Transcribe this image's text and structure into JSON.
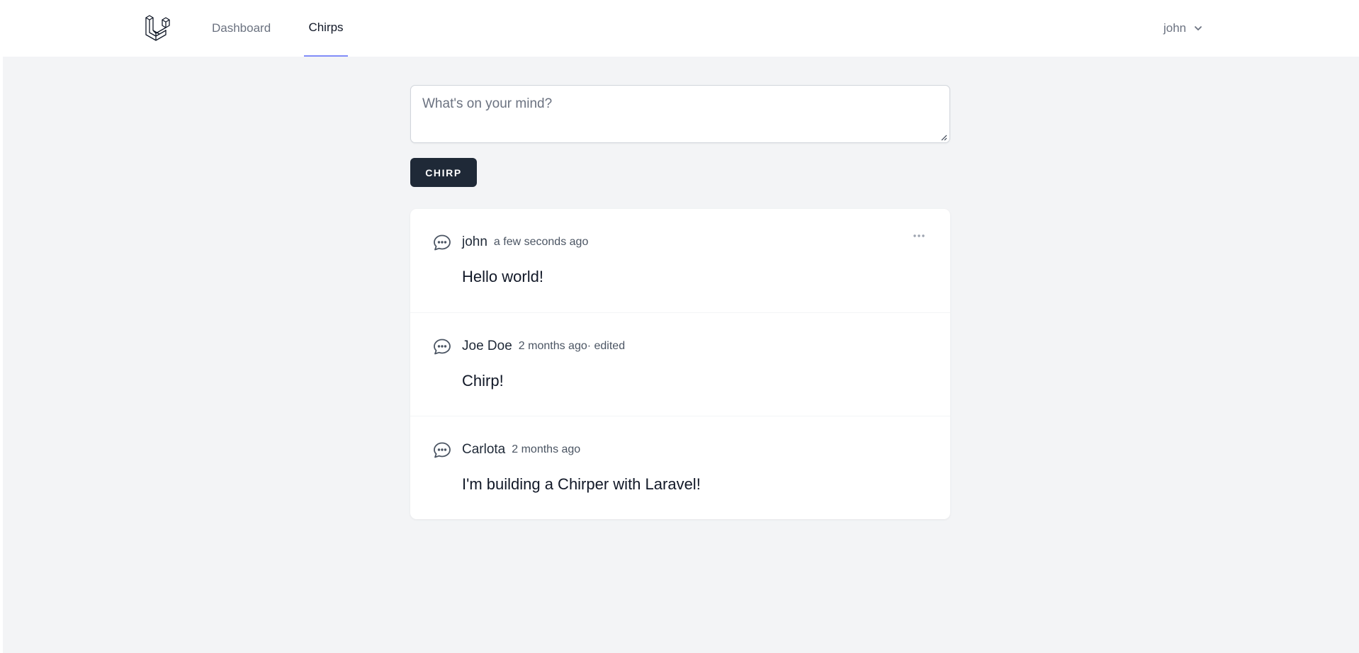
{
  "nav": {
    "logo_icon": "laravel-logo-icon",
    "links": [
      {
        "label": "Dashboard",
        "active": false
      },
      {
        "label": "Chirps",
        "active": true
      }
    ],
    "user": {
      "name": "john",
      "icon": "chevron-down-icon"
    }
  },
  "composer": {
    "placeholder": "What's on your mind?",
    "value": "",
    "submit_label": "CHIRP"
  },
  "chirps": [
    {
      "author": "john",
      "time": "a few seconds ago",
      "edited": "",
      "message": "Hello world!",
      "has_menu": true
    },
    {
      "author": "Joe Doe",
      "time": "2 months ago",
      "edited": " · edited",
      "message": "Chirp!",
      "has_menu": false
    },
    {
      "author": "Carlota",
      "time": "2 months ago",
      "edited": "",
      "message": "I'm building a Chirper with Laravel!",
      "has_menu": false
    }
  ],
  "colors": {
    "page_background": "#f3f4f6",
    "button_background": "#1f2937",
    "active_tab_underline": "#818cf8",
    "muted_text": "#6b7280"
  }
}
